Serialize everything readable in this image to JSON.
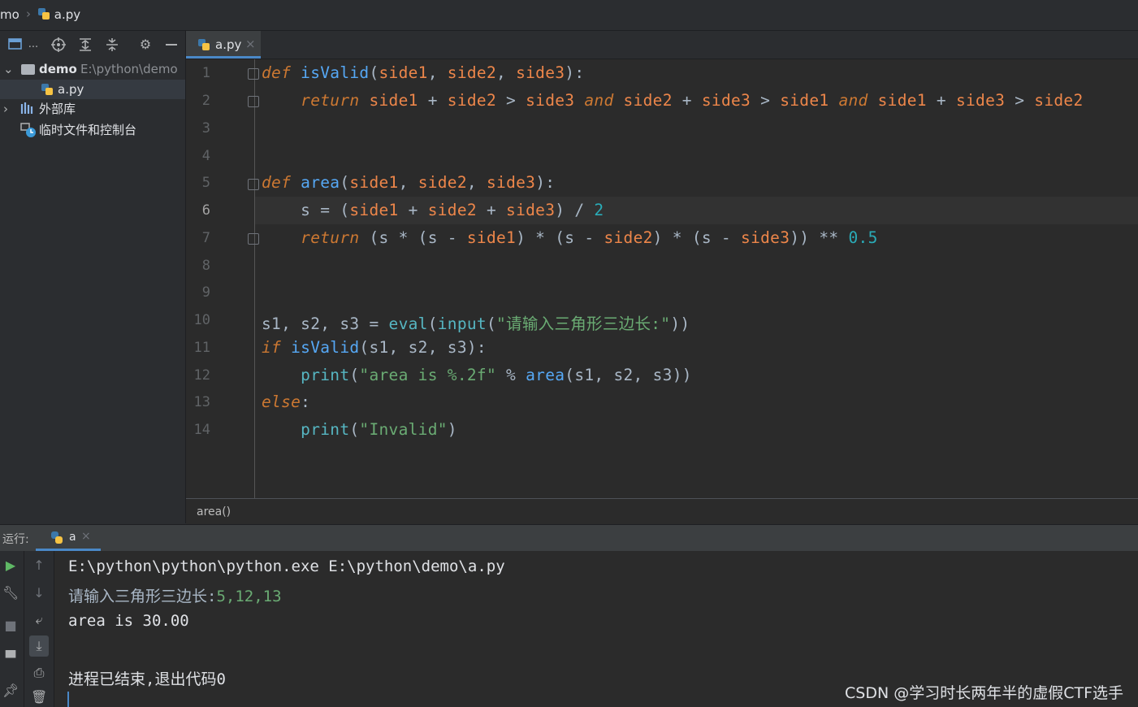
{
  "breadcrumb": {
    "project": "mo",
    "file": "a.py"
  },
  "project_panel": {
    "toolbar_icons": [
      "project-view-icon",
      "ellipsis",
      "locate-icon",
      "expand-all-icon",
      "collapse-all-icon",
      "gear-icon",
      "minimize-icon"
    ],
    "toolbar_more": "...",
    "tree": [
      {
        "label": "demo",
        "path": "E:\\python\\demo"
      },
      {
        "label": "a.py"
      },
      {
        "label": "外部库"
      },
      {
        "label": "临时文件和控制台"
      }
    ]
  },
  "editor": {
    "tab": {
      "label": "a.py",
      "close": "×"
    },
    "line_numbers": [
      "1",
      "2",
      "3",
      "4",
      "5",
      "6",
      "7",
      "8",
      "9",
      "10",
      "11",
      "12",
      "13",
      "14"
    ],
    "current_line": "6"
  },
  "status_bar": {
    "breadcrumb": "area()"
  },
  "run_panel": {
    "label": "运行:",
    "tab": {
      "label": "a",
      "close": "×"
    },
    "output": [
      "E:\\python\\python\\python.exe E:\\python\\demo\\a.py",
      "请输入三角形三边长:",
      "5,12,13",
      "area is 30.00",
      "进程已结束,退出代码0"
    ]
  },
  "watermark": "CSDN @学习时长两年半的虚假CTF选手",
  "colors": {
    "keyword": "#cc7832",
    "function": "#56a8f5",
    "param": "#ed864a",
    "string": "#6aab73",
    "number": "#2aacb8",
    "accent": "#4a88c7"
  }
}
